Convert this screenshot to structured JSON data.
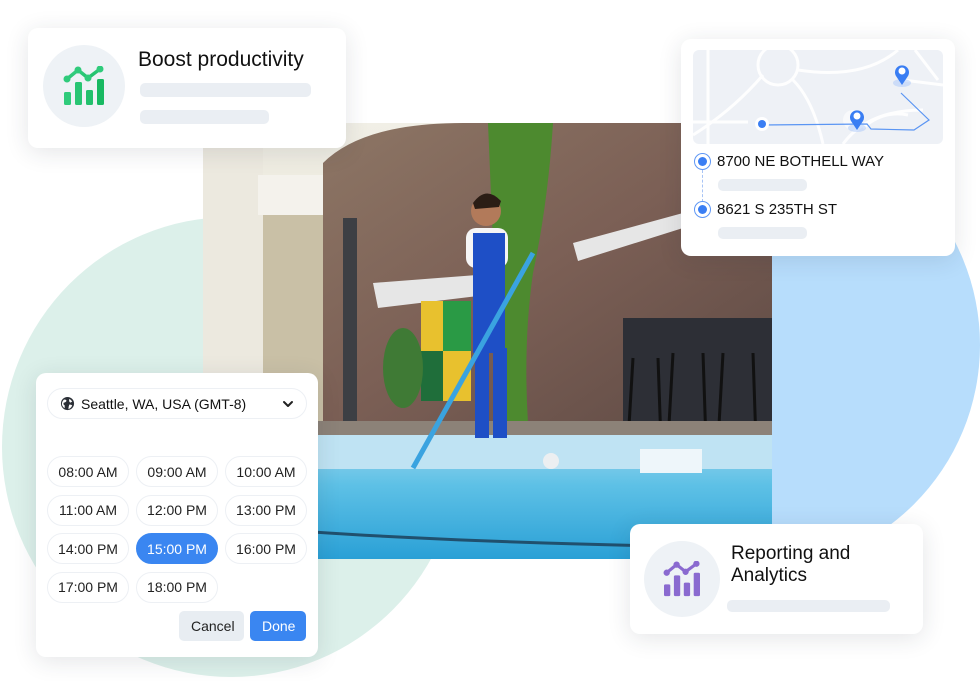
{
  "colors": {
    "accent_blue": "#3a86f1",
    "productivity_icon_green": "#22c772",
    "analytics_icon_purple": "#8a6ad0",
    "mint_circle": "#dcf0ea",
    "blue_circle": "#b7ddfc",
    "skeleton": "#eaeef3"
  },
  "photo": {
    "description": "Worker in blue overalls cleaning an outdoor swimming pool with a long-handled pool net in front of a stone wall"
  },
  "productivity_card": {
    "icon": "chart-growth-icon",
    "title": "Boost productivity"
  },
  "route_card": {
    "map_icon": "route-map",
    "stops": [
      {
        "icon": "radio-selected-icon",
        "address": "8700 NE BOTHELL WAY"
      },
      {
        "icon": "radio-selected-icon",
        "address": "8621 S 235TH ST"
      }
    ]
  },
  "scheduler": {
    "location": {
      "icon": "globe-icon",
      "value": "Seattle, WA, USA (GMT-8)",
      "chevron": "chevron-down-icon"
    },
    "time_slots": [
      {
        "label": "08:00 AM",
        "selected": false
      },
      {
        "label": "09:00 AM",
        "selected": false
      },
      {
        "label": "10:00 AM",
        "selected": false
      },
      {
        "label": "11:00 AM",
        "selected": false
      },
      {
        "label": "12:00 PM",
        "selected": false
      },
      {
        "label": "13:00 PM",
        "selected": false
      },
      {
        "label": "14:00 PM",
        "selected": false
      },
      {
        "label": "15:00 PM",
        "selected": true
      },
      {
        "label": "16:00 PM",
        "selected": false
      },
      {
        "label": "17:00 PM",
        "selected": false
      },
      {
        "label": "18:00 PM",
        "selected": false
      }
    ],
    "cancel_label": "Cancel",
    "done_label": "Done"
  },
  "reporting_card": {
    "icon": "chart-growth-icon",
    "title_line1": "Reporting and",
    "title_line2": "Analytics"
  }
}
